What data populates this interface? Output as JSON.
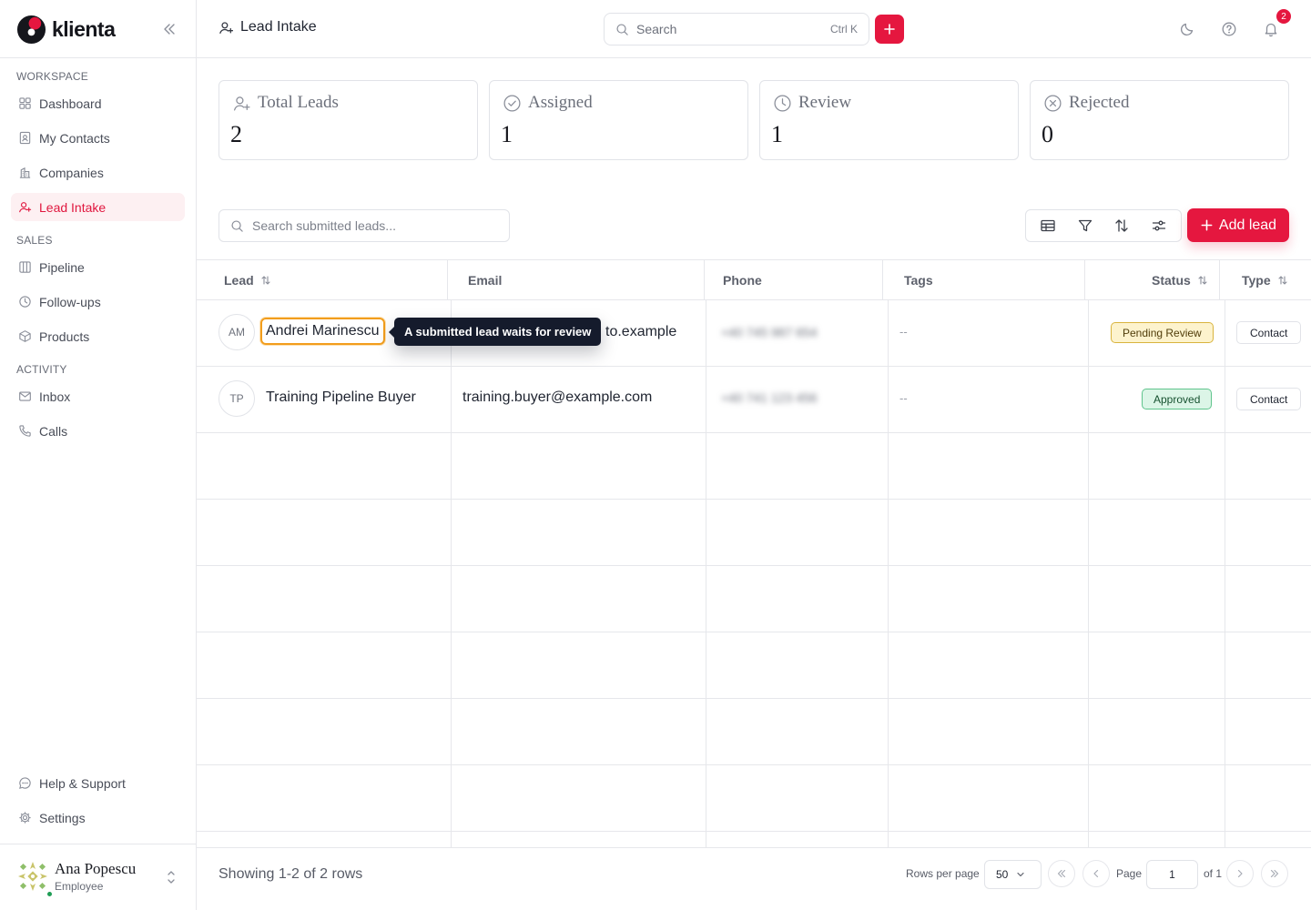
{
  "app": {
    "brand_name": "klienta",
    "accent_color": "#e5173f"
  },
  "sidebar": {
    "sections": [
      {
        "label": "WORKSPACE"
      },
      {
        "label": "SALES"
      },
      {
        "label": "ACTIVITY"
      }
    ],
    "items": [
      {
        "label": "Dashboard",
        "icon": "grid-icon"
      },
      {
        "label": "My Contacts",
        "icon": "contact-card-icon"
      },
      {
        "label": "Companies",
        "icon": "building-icon"
      },
      {
        "label": "Lead Intake",
        "icon": "user-plus-icon",
        "active": true
      },
      {
        "label": "Pipeline",
        "icon": "kanban-icon"
      },
      {
        "label": "Follow-ups",
        "icon": "clock-icon"
      },
      {
        "label": "Products",
        "icon": "box-icon"
      },
      {
        "label": "Inbox",
        "icon": "mail-icon"
      },
      {
        "label": "Calls",
        "icon": "phone-icon"
      }
    ],
    "bottom_items": [
      {
        "label": "Help & Support",
        "icon": "chat-icon"
      },
      {
        "label": "Settings",
        "icon": "gear-icon"
      }
    ],
    "user": {
      "name": "Ana Popescu",
      "role": "Employee"
    }
  },
  "header": {
    "title": "Lead Intake",
    "search_placeholder": "Search",
    "search_shortcut": "Ctrl K",
    "notification_count": "2"
  },
  "stats": [
    {
      "label": "Total Leads",
      "value": "2",
      "icon": "user-plus-icon"
    },
    {
      "label": "Assigned",
      "value": "1",
      "icon": "check-circle-icon"
    },
    {
      "label": "Review",
      "value": "1",
      "icon": "clock-icon"
    },
    {
      "label": "Rejected",
      "value": "0",
      "icon": "x-circle-icon"
    }
  ],
  "toolbar": {
    "search_placeholder": "Search submitted leads...",
    "add_lead_label": "Add lead"
  },
  "table": {
    "columns": [
      "Lead",
      "Email",
      "Phone",
      "Tags",
      "Status",
      "Type"
    ],
    "rows": [
      {
        "initials": "AM",
        "name": "Andrei Marinescu",
        "email": "to.example",
        "phone": "+40 745 987 654",
        "tags": "--",
        "status": "Pending Review",
        "type": "Contact"
      },
      {
        "initials": "TP",
        "name": "Training Pipeline Buyer",
        "email": "training.buyer@example.com",
        "phone": "+40 741 123 456",
        "tags": "--",
        "status": "Approved",
        "type": "Contact"
      }
    ],
    "tooltip": "A submitted lead waits for review"
  },
  "footer": {
    "showing": "Showing 1-2 of 2 rows",
    "rows_per_page_label": "Rows per page",
    "rows_per_page_value": "50",
    "page_label": "Page",
    "page_value": "1",
    "of_label": "of 1"
  }
}
